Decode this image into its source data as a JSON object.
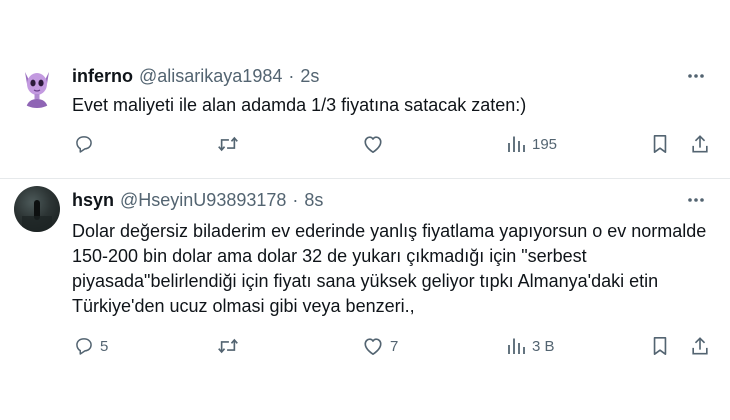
{
  "tweets": [
    {
      "display_name": "inferno",
      "handle": "@alisarikaya1984",
      "separator": "·",
      "time": "2s",
      "text": "Evet maliyeti ile alan adamda 1/3 fiyatına satacak zaten:)",
      "replies": "",
      "retweets": "",
      "likes": "",
      "views": "195"
    },
    {
      "display_name": "hsyn",
      "handle": "@HseyinU93893178",
      "separator": "·",
      "time": "8s",
      "text": "Dolar değersiz biladerim ev ederinde yanlış fiyatlama yapıyorsun o ev normalde 150-200 bin dolar ama dolar 32 de yukarı çıkmadığı için \"serbest piyasada\"belirlendiği için fiyatı sana yüksek geliyor tıpkı Almanya'daki etin Türkiye'den ucuz olmasi gibi veya benzeri.,",
      "replies": "5",
      "retweets": "",
      "likes": "7",
      "views": "3 B"
    }
  ],
  "icons": {
    "reply": "reply-icon",
    "retweet": "retweet-icon",
    "like": "heart-icon",
    "views": "views-icon",
    "bookmark": "bookmark-icon",
    "share": "share-icon",
    "more": "more-icon"
  },
  "colors": {
    "text": "#0f1419",
    "secondary": "#536471",
    "divider": "#e6e9eb",
    "avatar_1_accent": "#b98fd6"
  }
}
